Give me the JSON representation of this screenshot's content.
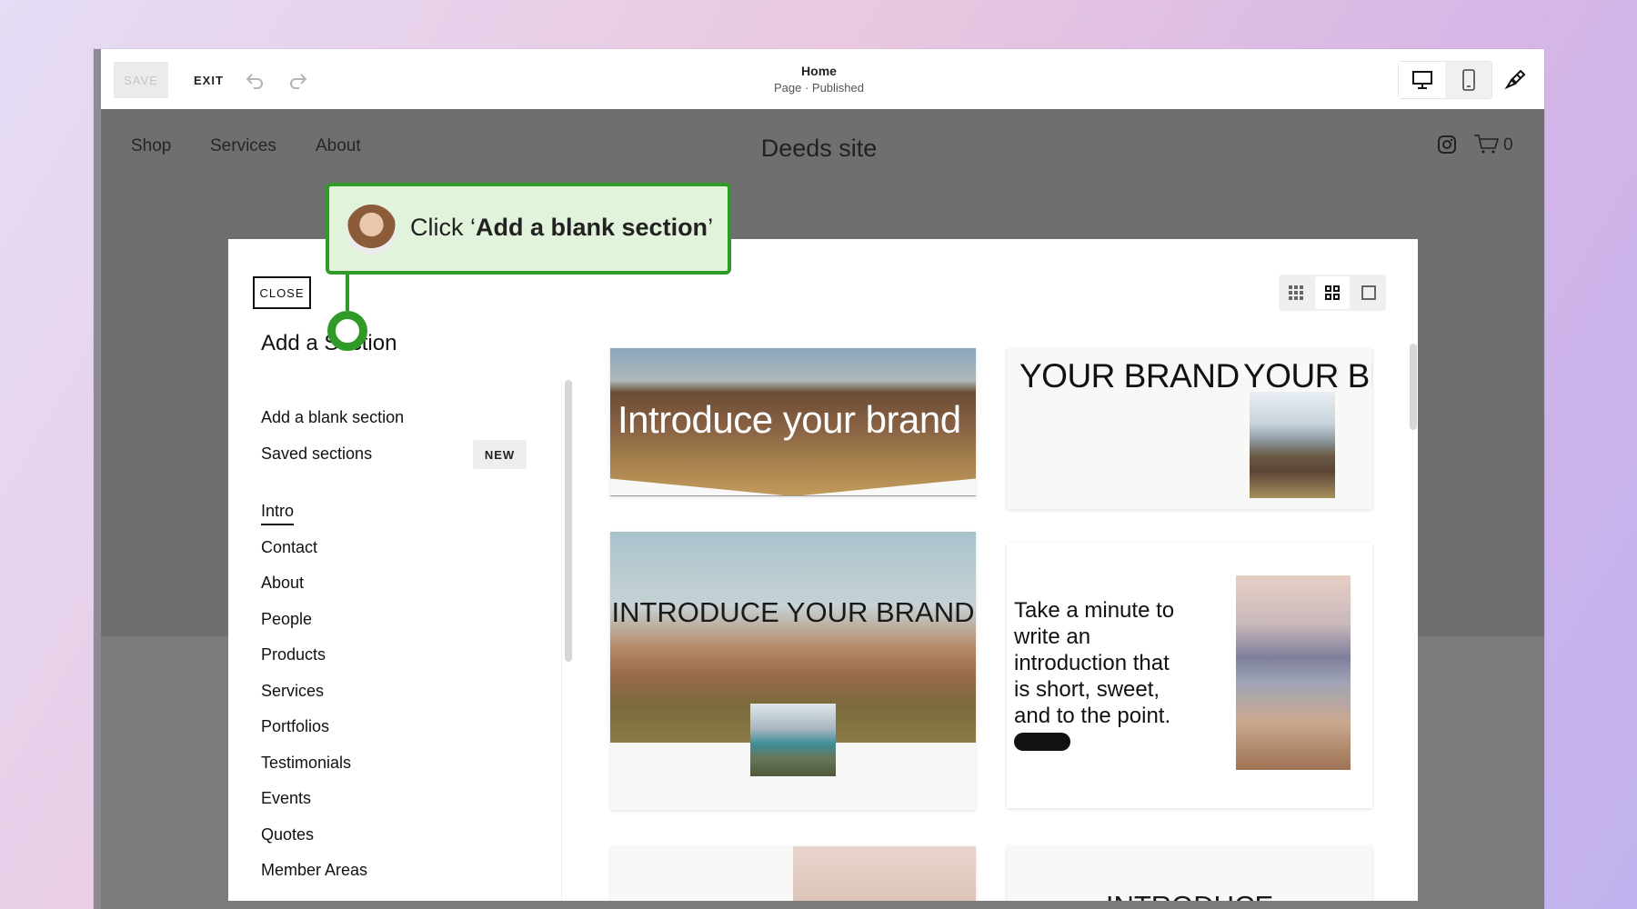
{
  "toolbar": {
    "save_label": "SAVE",
    "exit_label": "EXIT",
    "page_title": "Home",
    "page_status": "Page · Published"
  },
  "site": {
    "nav": [
      "Shop",
      "Services",
      "About"
    ],
    "title": "Deeds site",
    "cart_count": "0"
  },
  "panel": {
    "close_label": "CLOSE",
    "title": "Add a Section",
    "actions": {
      "blank": "Add a blank section",
      "saved": "Saved sections",
      "new_badge": "NEW"
    },
    "categories": [
      "Intro",
      "Contact",
      "About",
      "People",
      "Products",
      "Services",
      "Portfolios",
      "Testimonials",
      "Events",
      "Quotes",
      "Member Areas"
    ],
    "active_category": "Intro"
  },
  "templates": {
    "t1": "Introduce your brand",
    "t2": "YOUR BRAND",
    "t2b": "YOUR BR",
    "t3": "INTRODUCE YOUR BRAND",
    "t4": "Take a minute to write an introduction that is short, sweet, and to the point.",
    "t6": "INTRODUCE"
  },
  "callout": {
    "prefix": "Click ‘",
    "bold": "Add a blank section",
    "suffix": "’"
  },
  "colors": {
    "accent_green": "#2f9a25",
    "callout_bg": "#e2f3db"
  }
}
